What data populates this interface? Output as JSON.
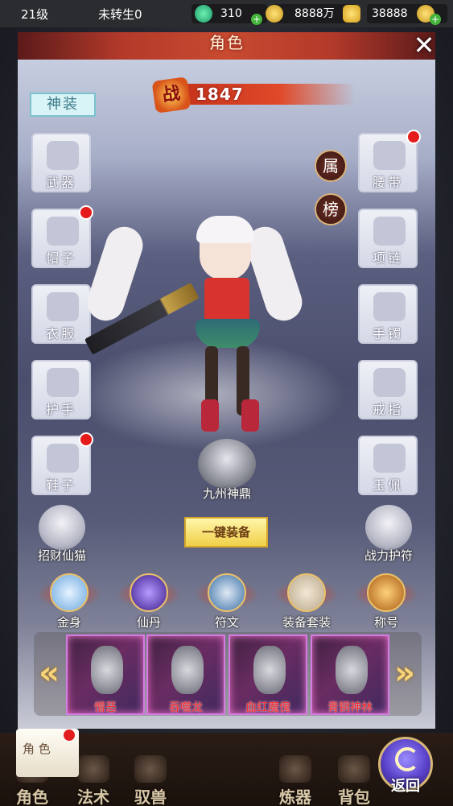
{
  "status_bar": {
    "level": "21级",
    "reborn": "未转生0",
    "jade": "310",
    "coins": "8888万",
    "ingots": "38888"
  },
  "panel": {
    "title": "角色",
    "close": "✕",
    "combat_power_emblem": "战",
    "combat_power": "1847",
    "tag": "神装",
    "attr_button": "属",
    "rank_button": "榜"
  },
  "equipment_left": [
    {
      "label": "武器",
      "badge": false
    },
    {
      "label": "帽子",
      "badge": true
    },
    {
      "label": "衣服",
      "badge": false
    },
    {
      "label": "护手",
      "badge": false
    },
    {
      "label": "鞋子",
      "badge": true
    }
  ],
  "equipment_right": [
    {
      "label": "腰带",
      "badge": true
    },
    {
      "label": "项链",
      "badge": false
    },
    {
      "label": "手镯",
      "badge": false
    },
    {
      "label": "戒指",
      "badge": false
    },
    {
      "label": "玉佩",
      "badge": false
    }
  ],
  "center": {
    "cauldron": "九州神鼎",
    "one_key_equip": "一键装备",
    "lucky_cat": "招财仙猫",
    "charm": "战力护符"
  },
  "features": [
    {
      "label": "金身",
      "color": "#6aa7e0"
    },
    {
      "label": "仙丹",
      "color": "#6a3fc4"
    },
    {
      "label": "符文",
      "color": "#3a6fa8"
    },
    {
      "label": "装备套装",
      "color": "#b9a68a"
    },
    {
      "label": "称号",
      "color": "#d98a2a"
    }
  ],
  "carousel": {
    "left_arrow": "«",
    "right_arrow": "»",
    "cards": [
      "憎恶",
      "吞噬龙",
      "血红魔傀",
      "青铜神林"
    ]
  },
  "bottom_nav": {
    "items": [
      "角色",
      "法术",
      "驭兽",
      "炼器",
      "背包"
    ],
    "role_card": "角  色",
    "back": "返回"
  },
  "colors": {
    "accent_red": "#c84a30",
    "badge_red": "#e51b1b",
    "card_border": "#d57ce2",
    "card_label": "#ff2a2a"
  }
}
